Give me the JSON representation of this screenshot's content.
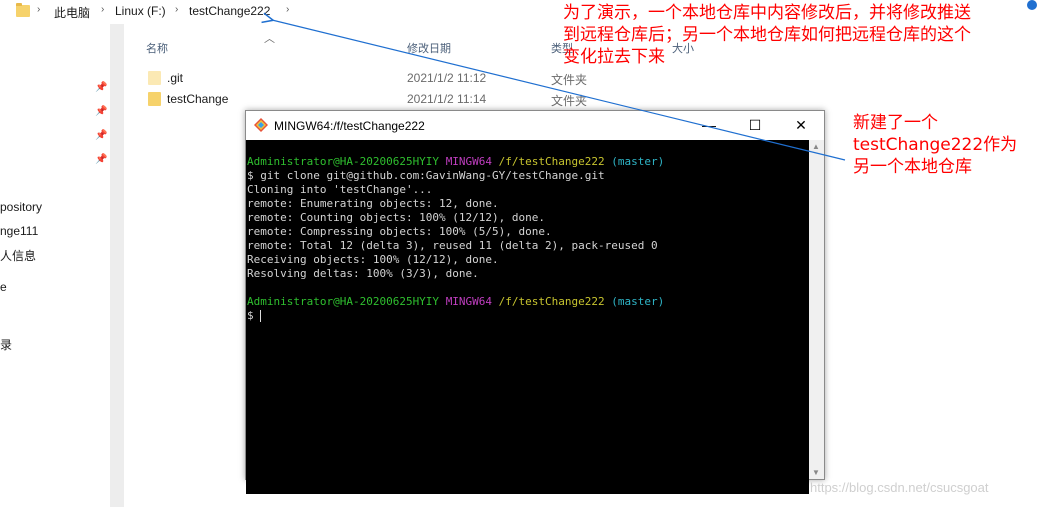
{
  "explorer": {
    "breadcrumb": [
      "此电脑",
      "Linux (F:)",
      "testChange222"
    ],
    "columns": {
      "name": "名称",
      "modified": "修改日期",
      "type": "类型",
      "size": "大小"
    },
    "files": [
      {
        "name": ".git",
        "modified": "2021/1/2 11:12",
        "type": "文件夹"
      },
      {
        "name": "testChange",
        "modified": "2021/1/2 11:14",
        "type": "文件夹"
      }
    ],
    "nav_fragments": [
      "pository",
      "nge111",
      "人信息",
      "e",
      "录"
    ]
  },
  "terminal": {
    "title": "MINGW64:/f/testChange222",
    "controls": {
      "minimize": "—",
      "maximize": "☐",
      "close": "✕"
    },
    "prompt": {
      "user": "Administrator@HA-20200625HYIY",
      "env": "MINGW64",
      "path": "/f/testChange222",
      "branch": "(master)"
    },
    "lines": [
      "$ git clone git@github.com:GavinWang-GY/testChange.git",
      "Cloning into 'testChange'...",
      "remote: Enumerating objects: 12, done.",
      "remote: Counting objects: 100% (12/12), done.",
      "remote: Compressing objects: 100% (5/5), done.",
      "remote: Total 12 (delta 3), reused 11 (delta 2), pack-reused 0",
      "Receiving objects: 100% (12/12), done.",
      "Resolving deltas: 100% (3/3), done."
    ],
    "final_prompt": "$"
  },
  "annotations": {
    "top": [
      "为了演示，一个本地仓库中内容修改后，并将修改推送",
      "到远程仓库后；另一个本地仓库如何把远程仓库的这个",
      "变化拉去下来"
    ],
    "side": [
      "新建了一个",
      "testChange222作为",
      "另一个本地仓库"
    ],
    "color": "#ff0000",
    "arrow_color": "#1f6fd0"
  },
  "watermark": "https://blog.csdn.net/csucsgoat"
}
